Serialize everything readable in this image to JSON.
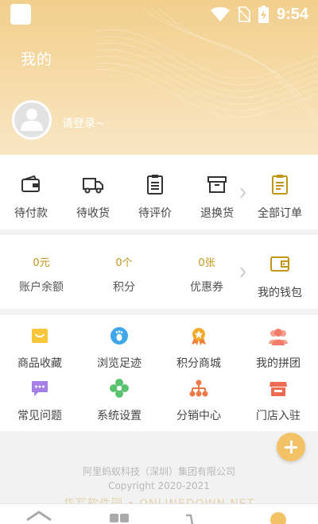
{
  "status_bar": {
    "time": "9:54"
  },
  "header": {
    "title": "我的",
    "login_text": "请登录~"
  },
  "orders": [
    {
      "label": "待付款",
      "icon": "wallet-icon"
    },
    {
      "label": "待收货",
      "icon": "truck-icon"
    },
    {
      "label": "待评价",
      "icon": "clipboard-icon"
    },
    {
      "label": "退换货",
      "icon": "box-icon"
    },
    {
      "label": "全部订单",
      "icon": "orders-list-icon"
    }
  ],
  "wallet": {
    "items": [
      {
        "value": "0元",
        "label": "账户余额"
      },
      {
        "value": "0个",
        "label": "积分"
      },
      {
        "value": "0张",
        "label": "优惠券"
      }
    ],
    "my_wallet_label": "我的钱包"
  },
  "tools": [
    {
      "label": "商品收藏",
      "icon": "favorites-icon",
      "color": "#f7c63a"
    },
    {
      "label": "浏览足迹",
      "icon": "footprint-icon",
      "color": "#3fa6ea"
    },
    {
      "label": "积分商城",
      "icon": "medal-icon",
      "color": "#f3a92d"
    },
    {
      "label": "我的拼团",
      "icon": "group-icon",
      "color": "#f27b6a"
    },
    {
      "label": "常见问题",
      "icon": "chat-icon",
      "color": "#a57fe6"
    },
    {
      "label": "系统设置",
      "icon": "settings-flower-icon",
      "color": "#59c26f"
    },
    {
      "label": "分销中心",
      "icon": "network-icon",
      "color": "#ee7a47"
    },
    {
      "label": "门店入驻",
      "icon": "store-icon",
      "color": "#ef6b4f"
    }
  ],
  "footer": {
    "company": "阿里蚂蚁科技（深圳）集团有限公司",
    "copyright": "Copyright 2020-2021",
    "watermark": "华军软件园 • ONLINEDOWN.NET"
  },
  "colors": {
    "accent": "#c2951b",
    "header": "#f1cf8d",
    "fab": "#f3c266"
  }
}
